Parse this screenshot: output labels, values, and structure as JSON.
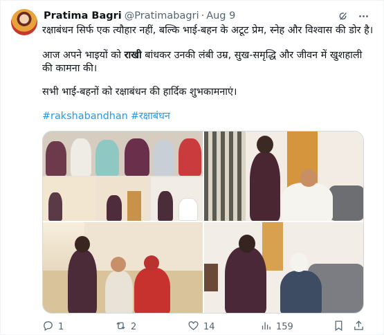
{
  "author": {
    "name": "Pratima Bagri",
    "handle": "@Pratimabagri",
    "separator": "·",
    "date": "Aug 9"
  },
  "tweet": {
    "line1": "रक्षाबंधन सिर्फ एक त्यौहार नहीं, बल्कि भाई-बहन के अटूट प्रेम, स्नेह और विश्वास की डोर है।",
    "line2_pre": "आज अपने भाइयों को ",
    "line2_bold": "राखी",
    "line2_post": " बांधकर उनकी लंबी उम्र, सुख-समृद्धि और जीवन में खुशहाली",
    "line3": "की कामना की।",
    "line4": "सभी भाई-बहनों को रक्षाबंधन की हार्दिक शुभकामनाएं।",
    "hashtags": [
      "#rakshabandhan",
      "#रक्षाबंधन"
    ]
  },
  "media": {
    "count": 4
  },
  "actions": {
    "replies": "1",
    "reposts": "2",
    "likes": "14",
    "views": "159"
  },
  "icons": {
    "header": [
      "grok-icon",
      "more-icon"
    ],
    "actions": [
      "reply-icon",
      "repost-icon",
      "like-icon",
      "views-icon",
      "bookmark-icon",
      "share-icon"
    ]
  },
  "colors": {
    "link": "#1d9bf0",
    "secondary_text": "#536471",
    "primary_text": "#0f1419"
  }
}
